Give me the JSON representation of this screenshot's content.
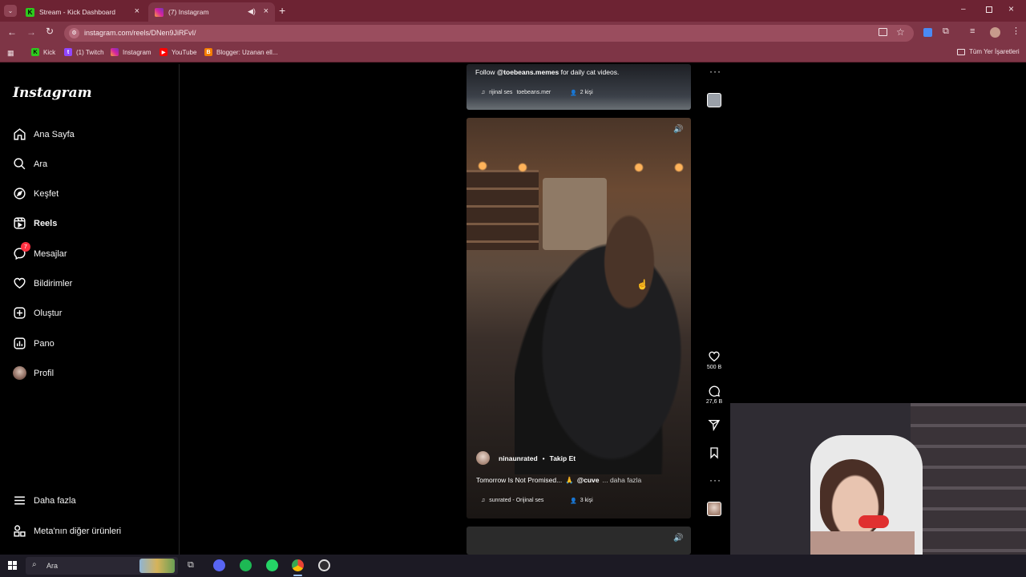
{
  "browser": {
    "tabs": [
      {
        "title": "Stream - Kick Dashboard",
        "favicon": "kick-icon"
      },
      {
        "title": "(7) Instagram",
        "favicon": "instagram-icon"
      }
    ],
    "url": "instagram.com/reels/DNen9JiRFvI/",
    "bookmarks": [
      "Kick",
      "(1) Twitch",
      "Instagram",
      "YouTube",
      "Blogger: Uzanan ell..."
    ],
    "all_bookmarks": "Tüm Yer İşaretleri",
    "theme_color": "#7e3546"
  },
  "sidebar": {
    "logo": "Instagram",
    "items": [
      {
        "label": "Ana Sayfa",
        "icon": "home-icon"
      },
      {
        "label": "Ara",
        "icon": "search-icon"
      },
      {
        "label": "Keşfet",
        "icon": "compass-icon"
      },
      {
        "label": "Reels",
        "icon": "reels-icon"
      },
      {
        "label": "Mesajlar",
        "icon": "messenger-icon",
        "badge": "7"
      },
      {
        "label": "Bildirimler",
        "icon": "heart-icon"
      },
      {
        "label": "Oluştur",
        "icon": "plus-square-icon"
      },
      {
        "label": "Pano",
        "icon": "dashboard-icon"
      },
      {
        "label": "Profil",
        "icon": "avatar-icon"
      }
    ],
    "more": "Daha fazla",
    "meta": "Meta'nın diğer ürünleri"
  },
  "reel_prev": {
    "caption_prefix": "Follow",
    "caption_user": "@toebeans.memes",
    "caption_suffix": "for daily cat videos.",
    "audio": "rijinal ses",
    "audio_user": "toebeans.mer",
    "people": "2 kişi"
  },
  "reel_main": {
    "username": "ninaunrated",
    "follow": "Takip Et",
    "caption_text": "Tomorrow Is Not Promised...",
    "caption_mention": "@cuve",
    "caption_more": "... daha fazla",
    "audio": "sunrated - Orijinal ses",
    "people": "3 kişi",
    "likes": "500 B",
    "comments": "27,6 B"
  },
  "taskbar": {
    "search": "Ara"
  }
}
